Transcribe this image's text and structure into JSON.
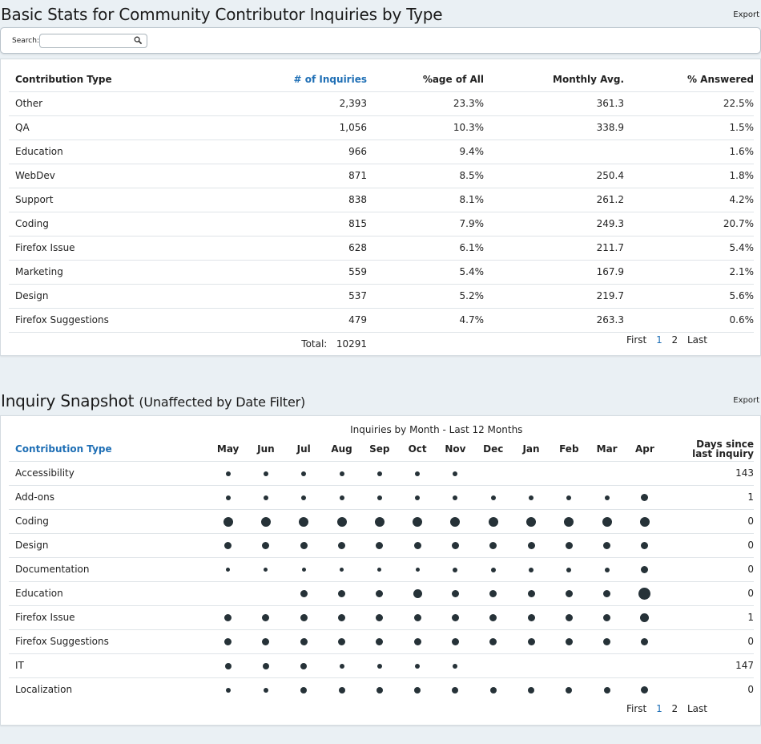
{
  "stats": {
    "title": "Basic Stats for Community Contributor Inquiries by Type",
    "export_label": "Export",
    "search": {
      "label": "Search:",
      "value": "",
      "placeholder": ""
    },
    "columns": [
      "Contribution Type",
      "# of Inquiries",
      "%age of All",
      "Monthly Avg.",
      "% Answered"
    ],
    "rows": [
      [
        "Other",
        "2,393",
        "23.3%",
        "361.3",
        "22.5%"
      ],
      [
        "QA",
        "1,056",
        "10.3%",
        "338.9",
        "1.5%"
      ],
      [
        "Education",
        "966",
        "9.4%",
        "",
        "1.6%"
      ],
      [
        "WebDev",
        "871",
        "8.5%",
        "250.4",
        "1.8%"
      ],
      [
        "Support",
        "838",
        "8.1%",
        "261.2",
        "4.2%"
      ],
      [
        "Coding",
        "815",
        "7.9%",
        "249.3",
        "20.7%"
      ],
      [
        "Firefox Issue",
        "628",
        "6.1%",
        "211.7",
        "5.4%"
      ],
      [
        "Marketing",
        "559",
        "5.4%",
        "167.9",
        "2.1%"
      ],
      [
        "Design",
        "537",
        "5.2%",
        "219.7",
        "5.6%"
      ],
      [
        "Firefox Suggestions",
        "479",
        "4.7%",
        "263.3",
        "0.6%"
      ]
    ],
    "total_label": "Total:",
    "total_value": "10291",
    "pager": {
      "first": "First",
      "pages": [
        "1",
        "2"
      ],
      "last": "Last"
    }
  },
  "snapshot": {
    "title": "Inquiry Snapshot",
    "subtitle": "(Unaffected by Date Filter)",
    "export_label": "Export",
    "group_header": "Inquiries by Month - Last 12 Months",
    "type_header": "Contribution Type",
    "months": [
      "May",
      "Jun",
      "Jul",
      "Aug",
      "Sep",
      "Oct",
      "Nov",
      "Dec",
      "Jan",
      "Feb",
      "Mar",
      "Apr"
    ],
    "days_header_line1": "Days since",
    "days_header_line2": "last inquiry",
    "rows": [
      {
        "type": "Accessibility",
        "levels": [
          1,
          1,
          1,
          1,
          1,
          1,
          1,
          0,
          0,
          0,
          0,
          0
        ],
        "days": "143"
      },
      {
        "type": "Add-ons",
        "levels": [
          1,
          1,
          1,
          1,
          1,
          1,
          1,
          1,
          1,
          1,
          1,
          2
        ],
        "days": "1"
      },
      {
        "type": "Coding",
        "levels": [
          3,
          3,
          3,
          3,
          3,
          3,
          3,
          3,
          3,
          3,
          3,
          3
        ],
        "days": "0"
      },
      {
        "type": "Design",
        "levels": [
          2,
          2,
          2,
          2,
          2,
          2,
          2,
          2,
          2,
          2,
          2,
          2
        ],
        "days": "0"
      },
      {
        "type": "Documentation",
        "levels": [
          0.5,
          0.5,
          0.5,
          0.5,
          0.5,
          0.5,
          1,
          1,
          1,
          1,
          1,
          2
        ],
        "days": "0"
      },
      {
        "type": "Education",
        "levels": [
          0,
          0,
          2,
          2,
          2,
          2.5,
          2,
          2,
          2,
          2,
          2,
          4
        ],
        "days": "0"
      },
      {
        "type": "Firefox Issue",
        "levels": [
          2,
          2,
          2,
          2,
          2,
          2,
          2,
          2,
          2,
          2,
          2,
          2.5
        ],
        "days": "1"
      },
      {
        "type": "Firefox Suggestions",
        "levels": [
          2,
          2,
          2,
          2,
          2,
          2,
          2,
          2,
          2,
          2,
          2,
          2
        ],
        "days": "0"
      },
      {
        "type": "IT",
        "levels": [
          1.5,
          1.5,
          1.5,
          1,
          1,
          1,
          1,
          0,
          0,
          0,
          0,
          0
        ],
        "days": "147"
      },
      {
        "type": "Localization",
        "levels": [
          1,
          1,
          1.5,
          1.5,
          1.5,
          1.5,
          1.5,
          1.5,
          1.5,
          1.5,
          1.5,
          2
        ],
        "days": "0"
      }
    ],
    "pager": {
      "first": "First",
      "pages": [
        "1",
        "2"
      ],
      "last": "Last"
    }
  },
  "colors": {
    "link": "#1f6fb5",
    "dot": "#263238",
    "background": "#eaf0f4"
  }
}
